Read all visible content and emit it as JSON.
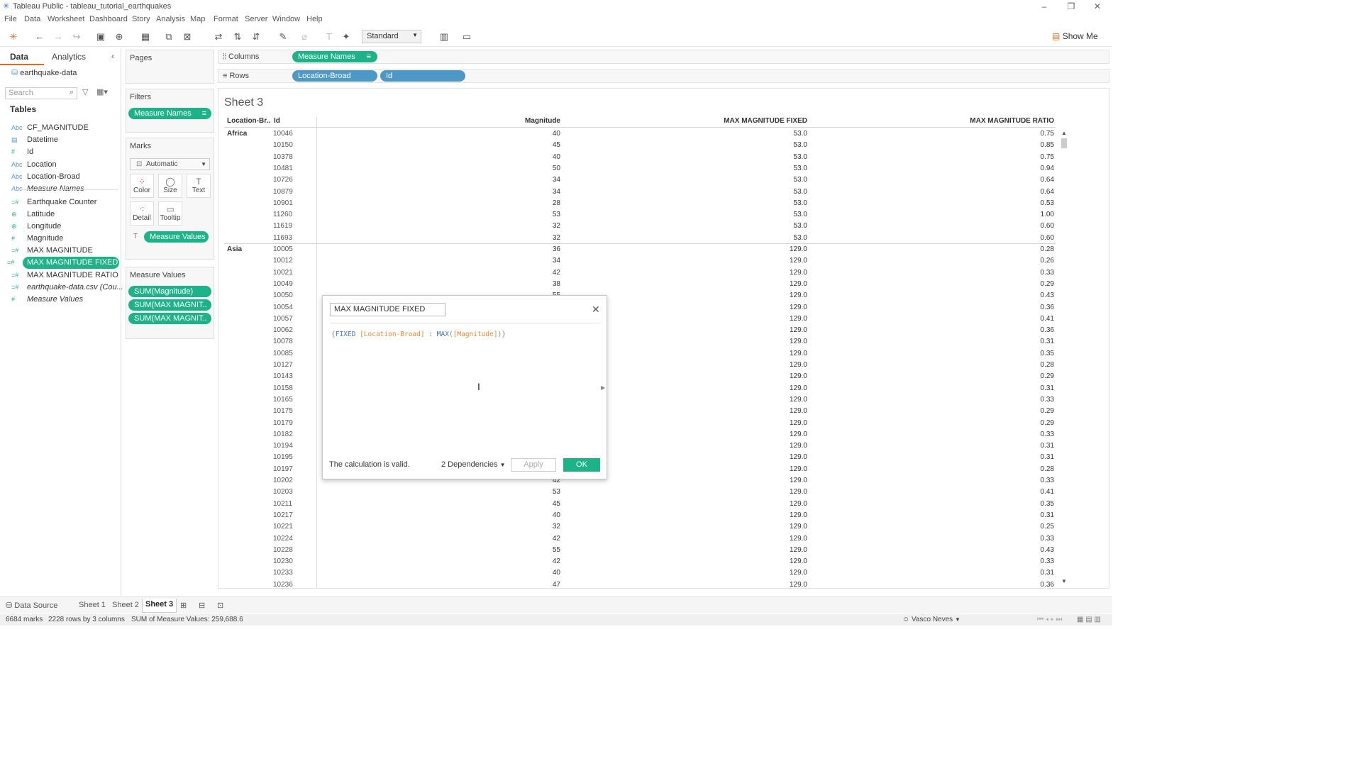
{
  "window": {
    "title": "Tableau Public - tableau_tutorial_earthquakes"
  },
  "menu": [
    "File",
    "Data",
    "Worksheet",
    "Dashboard",
    "Story",
    "Analysis",
    "Map",
    "Format",
    "Server",
    "Window",
    "Help"
  ],
  "toolbar": {
    "fit_select": "Standard",
    "show_me": "Show Me"
  },
  "datapane": {
    "tab_data": "Data",
    "tab_analytics": "Analytics",
    "datasource": "earthquake-data",
    "search_placeholder": "Search",
    "tables_header": "Tables",
    "fields": [
      {
        "name": "CF_MAGNITUDE",
        "type": "Abc"
      },
      {
        "name": "Datetime",
        "type": "date"
      },
      {
        "name": "Id",
        "type": "#"
      },
      {
        "name": "Location",
        "type": "Abc"
      },
      {
        "name": "Location-Broad",
        "type": "Abc"
      },
      {
        "name": "Measure Names",
        "type": "Abc"
      },
      {
        "name": "Earthquake Counter",
        "type": "=#"
      },
      {
        "name": "Latitude",
        "type": "geo"
      },
      {
        "name": "Longitude",
        "type": "geo"
      },
      {
        "name": "Magnitude",
        "type": "#"
      },
      {
        "name": "MAX MAGNITUDE",
        "type": "=#"
      },
      {
        "name": "MAX MAGNITUDE FIXED",
        "type": "=#"
      },
      {
        "name": "MAX MAGNITUDE RATIO",
        "type": "=#"
      },
      {
        "name": "earthquake-data.csv (Cou...",
        "type": "=#"
      },
      {
        "name": "Measure Values",
        "type": "#"
      }
    ]
  },
  "cards": {
    "pages": "Pages",
    "filters": "Filters",
    "filter_pill": "Measure Names",
    "marks": "Marks",
    "marks_type": "Automatic",
    "mark_buttons": [
      "Color",
      "Size",
      "Text",
      "Detail",
      "Tooltip"
    ],
    "marks_pill": "Measure Values",
    "measure_values": "Measure Values",
    "mv_pills": [
      "SUM(Magnitude)",
      "SUM(MAX MAGNIT..",
      "SUM(MAX MAGNIT.."
    ]
  },
  "shelves": {
    "columns_label": "Columns",
    "columns_pill": "Measure Names",
    "rows_label": "Rows",
    "rows_pill1": "Location-Broad",
    "rows_pill2": "Id"
  },
  "sheet": {
    "title": "Sheet 3",
    "headers": [
      "Location-Br..",
      "Id",
      "Magnitude",
      "MAX MAGNITUDE FIXED",
      "MAX MAGNITUDE RATIO"
    ],
    "rows": [
      [
        "Africa",
        "10046",
        "40",
        "53.0",
        "0.75"
      ],
      [
        "",
        "10150",
        "45",
        "53.0",
        "0.85"
      ],
      [
        "",
        "10378",
        "40",
        "53.0",
        "0.75"
      ],
      [
        "",
        "10481",
        "50",
        "53.0",
        "0.94"
      ],
      [
        "",
        "10726",
        "34",
        "53.0",
        "0.64"
      ],
      [
        "",
        "10879",
        "34",
        "53.0",
        "0.64"
      ],
      [
        "",
        "10901",
        "28",
        "53.0",
        "0.53"
      ],
      [
        "",
        "11260",
        "53",
        "53.0",
        "1.00"
      ],
      [
        "",
        "11619",
        "32",
        "53.0",
        "0.60"
      ],
      [
        "",
        "11693",
        "32",
        "53.0",
        "0.60"
      ],
      [
        "Asia",
        "10005",
        "36",
        "129.0",
        "0.28"
      ],
      [
        "",
        "10012",
        "34",
        "129.0",
        "0.26"
      ],
      [
        "",
        "10021",
        "42",
        "129.0",
        "0.33"
      ],
      [
        "",
        "10049",
        "38",
        "129.0",
        "0.29"
      ],
      [
        "",
        "10050",
        "55",
        "129.0",
        "0.43"
      ],
      [
        "",
        "10054",
        "",
        "129.0",
        "0.36"
      ],
      [
        "",
        "10057",
        "",
        "129.0",
        "0.41"
      ],
      [
        "",
        "10062",
        "",
        "129.0",
        "0.36"
      ],
      [
        "",
        "10078",
        "",
        "129.0",
        "0.31"
      ],
      [
        "",
        "10085",
        "",
        "129.0",
        "0.35"
      ],
      [
        "",
        "10127",
        "",
        "129.0",
        "0.28"
      ],
      [
        "",
        "10143",
        "",
        "129.0",
        "0.29"
      ],
      [
        "",
        "10158",
        "",
        "129.0",
        "0.31"
      ],
      [
        "",
        "10165",
        "",
        "129.0",
        "0.33"
      ],
      [
        "",
        "10175",
        "",
        "129.0",
        "0.29"
      ],
      [
        "",
        "10179",
        "",
        "129.0",
        "0.29"
      ],
      [
        "",
        "10182",
        "",
        "129.0",
        "0.33"
      ],
      [
        "",
        "10194",
        "",
        "129.0",
        "0.31"
      ],
      [
        "",
        "10195",
        "",
        "129.0",
        "0.31"
      ],
      [
        "",
        "10197",
        "",
        "129.0",
        "0.28"
      ],
      [
        "",
        "10202",
        "42",
        "129.0",
        "0.33"
      ],
      [
        "",
        "10203",
        "53",
        "129.0",
        "0.41"
      ],
      [
        "",
        "10211",
        "45",
        "129.0",
        "0.35"
      ],
      [
        "",
        "10217",
        "40",
        "129.0",
        "0.31"
      ],
      [
        "",
        "10221",
        "32",
        "129.0",
        "0.25"
      ],
      [
        "",
        "10224",
        "42",
        "129.0",
        "0.33"
      ],
      [
        "",
        "10228",
        "55",
        "129.0",
        "0.43"
      ],
      [
        "",
        "10230",
        "42",
        "129.0",
        "0.33"
      ],
      [
        "",
        "10233",
        "40",
        "129.0",
        "0.31"
      ],
      [
        "",
        "10236",
        "47",
        "129.0",
        "0.36"
      ]
    ]
  },
  "dialog": {
    "calc_name": "MAX MAGNITUDE FIXED",
    "formula": {
      "open": "{",
      "kw1": "FIXED",
      "f1": "[Location-Broad]",
      "colon": " : ",
      "fn": "MAX",
      "paren_o": "(",
      "f2": "[Magnitude]",
      "close": ")}"
    },
    "valid": "The calculation is valid.",
    "dependencies": "2 Dependencies",
    "apply": "Apply",
    "ok": "OK"
  },
  "tabs": {
    "data_source": "Data Source",
    "sheets": [
      "Sheet 1",
      "Sheet 2",
      "Sheet 3"
    ]
  },
  "status": {
    "marks": "6684 marks",
    "rows": "2228 rows by 3 columns",
    "sum": "SUM of Measure Values: 259,688.6",
    "user": "Vasco Neves"
  }
}
